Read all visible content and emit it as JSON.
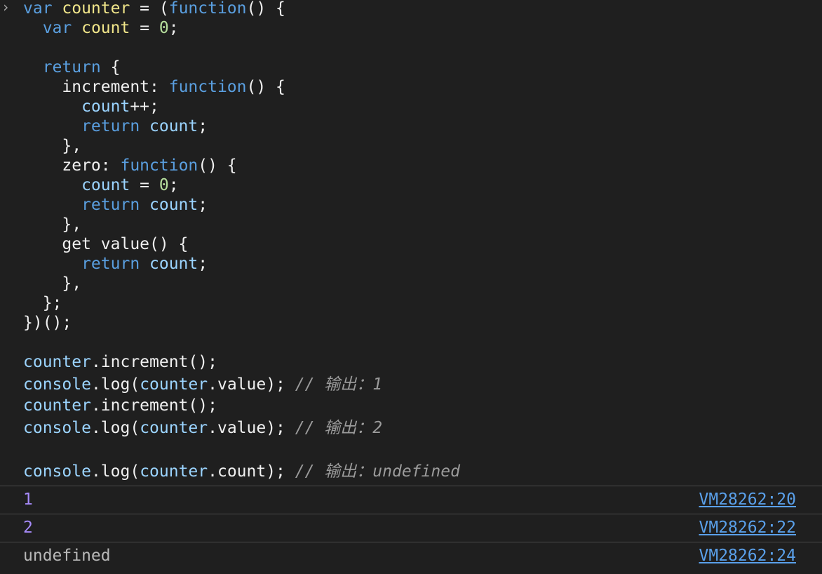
{
  "console": {
    "prompt_symbol": "›",
    "code_lines": [
      {
        "segments": [
          {
            "text": "var ",
            "cls": "kw"
          },
          {
            "text": "counter",
            "cls": "var"
          },
          {
            "text": " = (",
            "cls": "plain"
          },
          {
            "text": "function",
            "cls": "kw"
          },
          {
            "text": "() {",
            "cls": "plain"
          }
        ]
      },
      {
        "segments": [
          {
            "text": "  var ",
            "cls": "kw"
          },
          {
            "text": "count",
            "cls": "var"
          },
          {
            "text": " = ",
            "cls": "plain"
          },
          {
            "text": "0",
            "cls": "num"
          },
          {
            "text": ";",
            "cls": "plain"
          }
        ]
      },
      {
        "segments": [
          {
            "text": "",
            "cls": "plain"
          }
        ]
      },
      {
        "segments": [
          {
            "text": "  return",
            "cls": "kw"
          },
          {
            "text": " {",
            "cls": "plain"
          }
        ]
      },
      {
        "segments": [
          {
            "text": "    increment: ",
            "cls": "plain"
          },
          {
            "text": "function",
            "cls": "kw"
          },
          {
            "text": "() {",
            "cls": "plain"
          }
        ]
      },
      {
        "segments": [
          {
            "text": "      count",
            "cls": "id"
          },
          {
            "text": "++;",
            "cls": "plain"
          }
        ]
      },
      {
        "segments": [
          {
            "text": "      return",
            "cls": "kw"
          },
          {
            "text": " count",
            "cls": "id"
          },
          {
            "text": ";",
            "cls": "plain"
          }
        ]
      },
      {
        "segments": [
          {
            "text": "    },",
            "cls": "plain"
          }
        ]
      },
      {
        "segments": [
          {
            "text": "    zero: ",
            "cls": "plain"
          },
          {
            "text": "function",
            "cls": "kw"
          },
          {
            "text": "() {",
            "cls": "plain"
          }
        ]
      },
      {
        "segments": [
          {
            "text": "      count",
            "cls": "id"
          },
          {
            "text": " = ",
            "cls": "plain"
          },
          {
            "text": "0",
            "cls": "num"
          },
          {
            "text": ";",
            "cls": "plain"
          }
        ]
      },
      {
        "segments": [
          {
            "text": "      return",
            "cls": "kw"
          },
          {
            "text": " count",
            "cls": "id"
          },
          {
            "text": ";",
            "cls": "plain"
          }
        ]
      },
      {
        "segments": [
          {
            "text": "    },",
            "cls": "plain"
          }
        ]
      },
      {
        "segments": [
          {
            "text": "    get value() {",
            "cls": "plain"
          }
        ]
      },
      {
        "segments": [
          {
            "text": "      return",
            "cls": "kw"
          },
          {
            "text": " count",
            "cls": "id"
          },
          {
            "text": ";",
            "cls": "plain"
          }
        ]
      },
      {
        "segments": [
          {
            "text": "    },",
            "cls": "plain"
          }
        ]
      },
      {
        "segments": [
          {
            "text": "  };",
            "cls": "plain"
          }
        ]
      },
      {
        "segments": [
          {
            "text": "})();",
            "cls": "plain"
          }
        ]
      },
      {
        "segments": [
          {
            "text": "",
            "cls": "plain"
          }
        ]
      },
      {
        "segments": [
          {
            "text": "counter",
            "cls": "id"
          },
          {
            "text": ".increment();",
            "cls": "plain"
          }
        ]
      },
      {
        "segments": [
          {
            "text": "console",
            "cls": "id"
          },
          {
            "text": ".log(",
            "cls": "plain"
          },
          {
            "text": "counter",
            "cls": "id"
          },
          {
            "text": ".value); ",
            "cls": "plain"
          },
          {
            "text": "// 输出：1",
            "cls": "comment"
          }
        ]
      },
      {
        "segments": [
          {
            "text": "counter",
            "cls": "id"
          },
          {
            "text": ".increment();",
            "cls": "plain"
          }
        ]
      },
      {
        "segments": [
          {
            "text": "console",
            "cls": "id"
          },
          {
            "text": ".log(",
            "cls": "plain"
          },
          {
            "text": "counter",
            "cls": "id"
          },
          {
            "text": ".value); ",
            "cls": "plain"
          },
          {
            "text": "// 输出：2",
            "cls": "comment"
          }
        ]
      },
      {
        "segments": [
          {
            "text": "",
            "cls": "plain"
          }
        ]
      },
      {
        "segments": [
          {
            "text": "console",
            "cls": "id"
          },
          {
            "text": ".log(",
            "cls": "plain"
          },
          {
            "text": "counter",
            "cls": "id"
          },
          {
            "text": ".count); ",
            "cls": "plain"
          },
          {
            "text": "// 输出：undefined",
            "cls": "comment"
          }
        ]
      }
    ],
    "outputs": [
      {
        "value": "1",
        "kind": "number",
        "source": "VM28262:20"
      },
      {
        "value": "2",
        "kind": "number",
        "source": "VM28262:22"
      },
      {
        "value": "undefined",
        "kind": "undefined",
        "source": "VM28262:24"
      }
    ]
  }
}
